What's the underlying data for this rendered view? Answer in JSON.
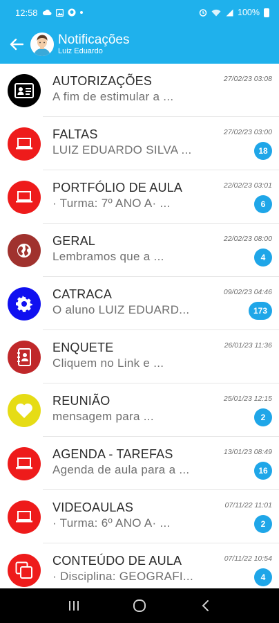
{
  "status_bar": {
    "time": "12:58",
    "battery": "100%",
    "icons": [
      "cloud-icon",
      "gallery-icon",
      "github-icon",
      "dot-icon",
      "alarm-icon",
      "wifi-icon",
      "signal-icon",
      "battery-icon"
    ]
  },
  "app_bar": {
    "title": "Notificações",
    "subtitle": "Luiz Eduardo",
    "back_icon": "arrow-left-icon",
    "avatar_icon": "avatar-icon"
  },
  "colors": {
    "primary": "#1fb1ec",
    "badge": "#1fa6e8",
    "red": "#ee1b1b",
    "black": "#000000",
    "brown": "#a0322e",
    "blue": "#1010f0",
    "yellow": "#e6dc15",
    "dark_red": "#c0282a"
  },
  "notifications": [
    {
      "title": "AUTORIZAÇÕES",
      "subtitle": "A fim de estimular a ...",
      "date": "27/02/23 03:08",
      "badge": "",
      "icon": "id-card-icon",
      "color": "#000000"
    },
    {
      "title": "FALTAS",
      "subtitle": "LUIZ EDUARDO SILVA ...",
      "date": "27/02/23 03:00",
      "badge": "18",
      "icon": "laptop-icon",
      "color": "#ee1b1b"
    },
    {
      "title": "PORTFÓLIO DE AULA",
      "subtitle": "· Turma: 7º ANO A· ...",
      "date": "22/02/23 03:01",
      "badge": "6",
      "icon": "laptop-icon",
      "color": "#ee1b1b"
    },
    {
      "title": "GERAL",
      "subtitle": "Lembramos que a ...",
      "date": "22/02/23 08:00",
      "badge": "4",
      "icon": "globe-icon",
      "color": "#a0322e"
    },
    {
      "title": "CATRACA",
      "subtitle": "O aluno LUIZ EDUARD...",
      "date": "09/02/23 04:46",
      "badge": "173",
      "icon": "gear-icon",
      "color": "#1010f0"
    },
    {
      "title": "ENQUETE",
      "subtitle": "Cliquem no Link e ...",
      "date": "26/01/23 11:36",
      "badge": "",
      "icon": "contacts-icon",
      "color": "#c0282a"
    },
    {
      "title": "REUNIÃO",
      "subtitle": "mensagem para ...",
      "date": "25/01/23 12:15",
      "badge": "2",
      "icon": "heart-icon",
      "color": "#e6dc15"
    },
    {
      "title": "AGENDA - TAREFAS",
      "subtitle": "Agenda de aula para a ...",
      "date": "13/01/23 08:49",
      "badge": "16",
      "icon": "laptop-icon",
      "color": "#ee1b1b"
    },
    {
      "title": "VIDEOAULAS",
      "subtitle": "· Turma: 6º ANO A· ...",
      "date": "07/11/22 11:01",
      "badge": "2",
      "icon": "laptop-icon",
      "color": "#ee1b1b"
    },
    {
      "title": "CONTEÚDO DE AULA",
      "subtitle": "· Disciplina: GEOGRAFI...",
      "date": "07/11/22 10:54",
      "badge": "4",
      "icon": "copy-icon",
      "color": "#ee1b1b"
    }
  ],
  "nav_bar": {
    "buttons": [
      "recent-apps-icon",
      "home-icon",
      "back-nav-icon"
    ]
  }
}
